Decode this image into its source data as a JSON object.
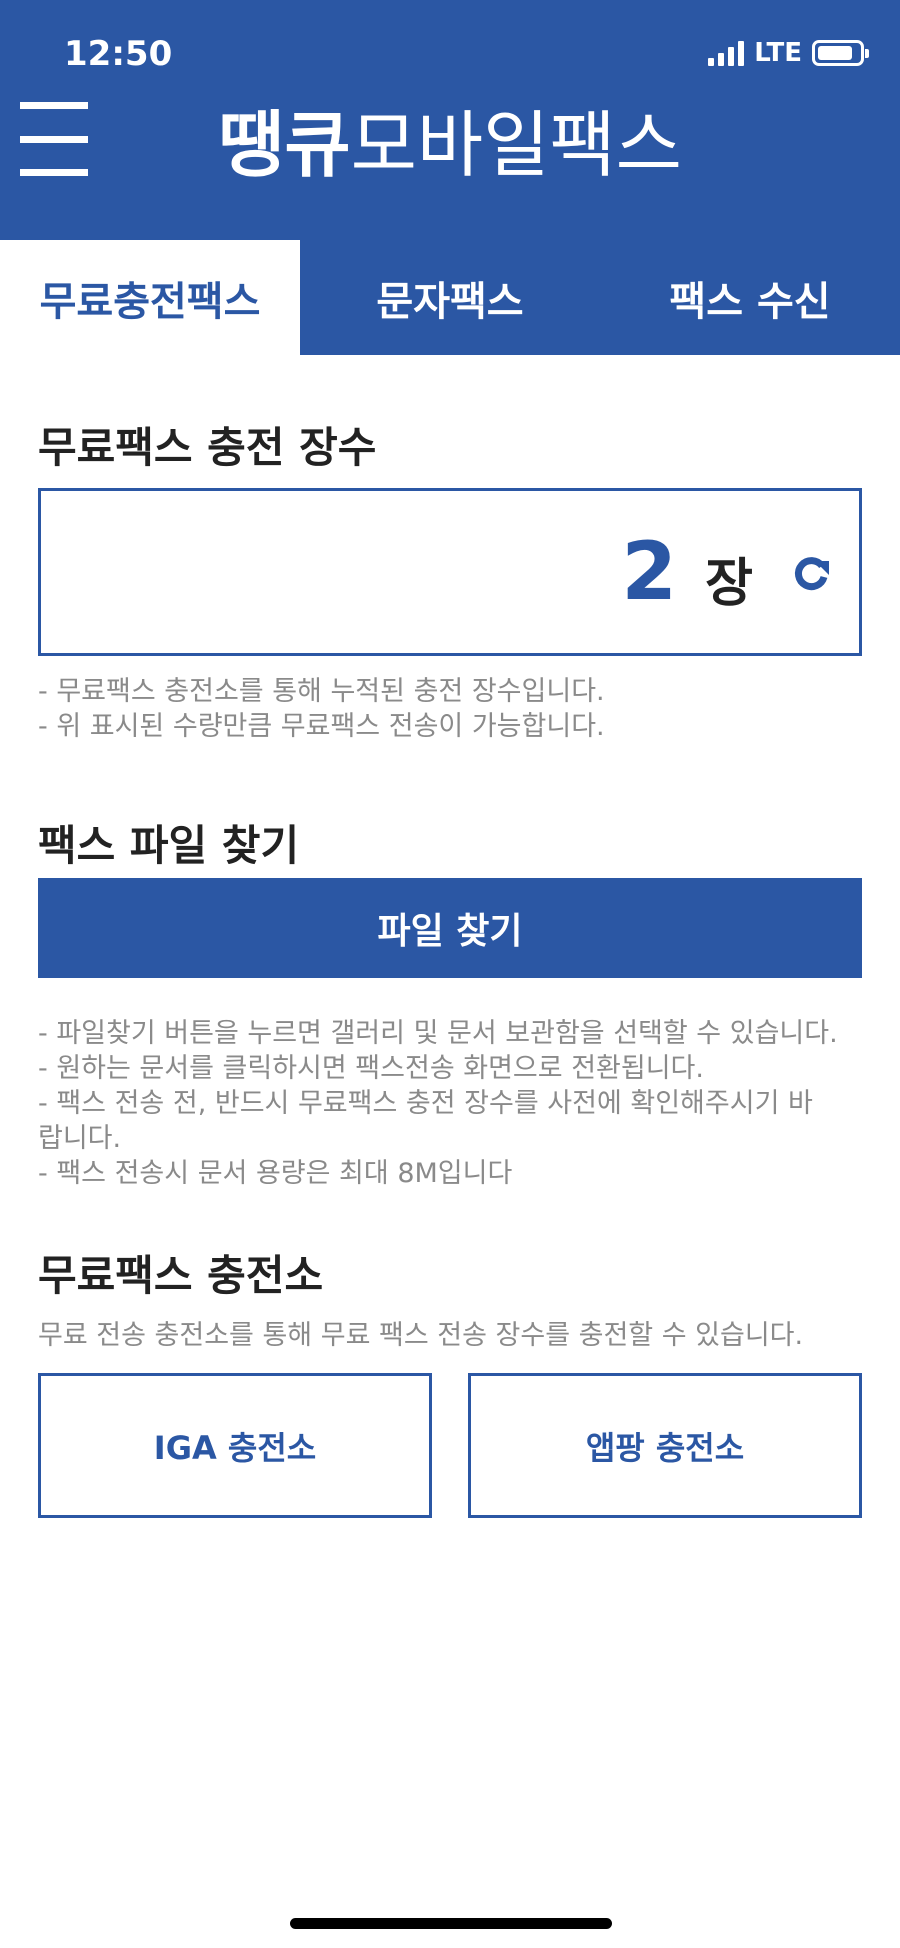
{
  "status_bar": {
    "time": "12:50",
    "network": "LTE"
  },
  "header": {
    "title_brand": "땡큐",
    "title_rest": "모바일팩스"
  },
  "tabs": [
    {
      "label": "무료충전팩스",
      "active": true
    },
    {
      "label": "문자팩스",
      "active": false
    },
    {
      "label": "팩스 수신",
      "active": false
    }
  ],
  "charge_section": {
    "title": "무료팩스 충전 장수",
    "count": "2",
    "unit": "장",
    "notes": [
      "- 무료팩스 충전소를 통해 누적된 충전 장수입니다.",
      "- 위 표시된 수량만큼 무료팩스 전송이 가능합니다."
    ]
  },
  "file_section": {
    "title": "팩스 파일 찾기",
    "button_label": "파일 찾기",
    "notes": [
      "- 파일찾기 버튼을 누르면 갤러리 및 문서 보관함을 선택할 수 있습니다.",
      "- 원하는 문서를 클릭하시면 팩스전송 화면으로 전환됩니다.",
      "- 팩스 전송 전, 반드시 무료팩스 충전 장수를 사전에 확인해주시기 바",
      "랍니다.",
      "- 팩스 전송시 문서 용량은 최대 8M입니다"
    ]
  },
  "station_section": {
    "title": "무료팩스 충전소",
    "description": "무료 전송 충전소를 통해 무료 팩스 전송 장수를 충전할 수 있습니다.",
    "buttons": [
      "IGA 충전소",
      "앱팡 충전소"
    ]
  },
  "colors": {
    "primary": "#2b57a4",
    "muted_text": "#8a8a8a"
  }
}
